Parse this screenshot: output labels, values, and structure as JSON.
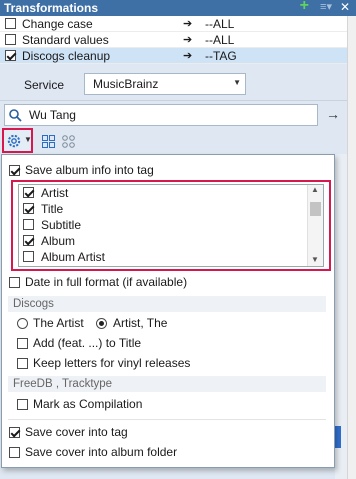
{
  "titlebar": {
    "title": "Transformations"
  },
  "transformations": [
    {
      "label": "Change case",
      "arrow": "➔",
      "action": "--ALL",
      "checked": false
    },
    {
      "label": "Standard values",
      "arrow": "➔",
      "action": "--ALL",
      "checked": false
    },
    {
      "label": "Discogs cleanup",
      "arrow": "➔",
      "action": "--TAG",
      "checked": true
    }
  ],
  "service": {
    "label": "Service",
    "value": "MusicBrainz"
  },
  "search": {
    "value": "Wu Tang"
  },
  "popup": {
    "save_album_info": "Save album info into tag",
    "fields": [
      {
        "label": "Artist",
        "checked": true
      },
      {
        "label": "Title",
        "checked": true
      },
      {
        "label": "Subtitle",
        "checked": false
      },
      {
        "label": "Album",
        "checked": true
      },
      {
        "label": "Album Artist",
        "checked": false
      }
    ],
    "date_full": "Date in full format (if available)",
    "discogs_header": "Discogs",
    "radio_the_artist": "The Artist",
    "radio_artist_the": "Artist, The",
    "add_feat": "Add (feat. ...) to Title",
    "keep_letters": "Keep letters for vinyl releases",
    "freedb_header": "FreeDB , Tracktype",
    "mark_compilation": "Mark as Compilation",
    "save_cover_tag": "Save cover into tag",
    "save_cover_folder": "Save cover into album folder"
  },
  "colors": {
    "title_bg": "#3e6fa5",
    "highlight_red": "#d6184f",
    "panel_bg": "#dfe8f2"
  }
}
